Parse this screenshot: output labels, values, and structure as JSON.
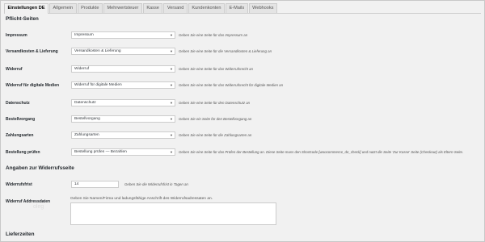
{
  "tabs": [
    "Einstellungen DE",
    "Allgemein",
    "Produkte",
    "Mehrwertsteuer",
    "Kasse",
    "Versand",
    "Kundenkonten",
    "E-Mails",
    "Webhooks"
  ],
  "section_pflicht": "Pflicht-Seiten",
  "pages": [
    {
      "label": "Impressum",
      "value": "Impressum",
      "desc": "Geben Sie eine Seite für das Impressum an"
    },
    {
      "label": "Versandkosten & Lieferung",
      "value": "Versandkosten & Lieferung",
      "desc": "Geben Sie eine Seite für die Versandkosten & Lieferung an"
    },
    {
      "label": "Widerruf",
      "value": "Widerruf",
      "desc": "Geben Sie eine Seite für das Widerrufsrecht an"
    },
    {
      "label": "Widerruf für digitale Medien",
      "value": "Widerruf für digitale Medien",
      "desc": "Geben Sie eine Seite für das Widerrufsrecht für digitale Medien an"
    },
    {
      "label": "Datenschutz",
      "value": "Datenschutz",
      "desc": "Geben Sie eine Seite für den Datenschutz an"
    },
    {
      "label": "Bestellvorgang",
      "value": "Bestellvorgang",
      "desc": "Geben Sie ein Seite für den Bestellvorgang an"
    },
    {
      "label": "Zahlungsarten",
      "value": "Zahlungsarten",
      "desc": "Geben Sie eine Seite für die Zahlungsarten an"
    },
    {
      "label": "Bestellung prüfen",
      "value": "Bestellung prüfen — Bezahlen",
      "desc": "Geben Sie eine Seite für das Prüfen der Bestellung an. Diese Seite muss den Shortcode [woocommerce_de_check] und nutzt die Seite 'Zur Kasse' Seite (Checkout) als Eltern-Seite."
    }
  ],
  "section_widerruf": "Angaben zur Widerrufsseite",
  "widerrufsfrist": {
    "label": "Widerrufsfrist",
    "value": "14",
    "desc": "Geben Sie die Widerrufsfrist in Tagen an"
  },
  "adressdaten": {
    "label": "Widerruf Addressdaten",
    "desc": "Geben Sie Namen/Firma und ladungsfähige Anschrift des Widerrufsadressaten an."
  },
  "ghost_text": "oleg",
  "section_lieferzeiten": "Lieferzeiten"
}
